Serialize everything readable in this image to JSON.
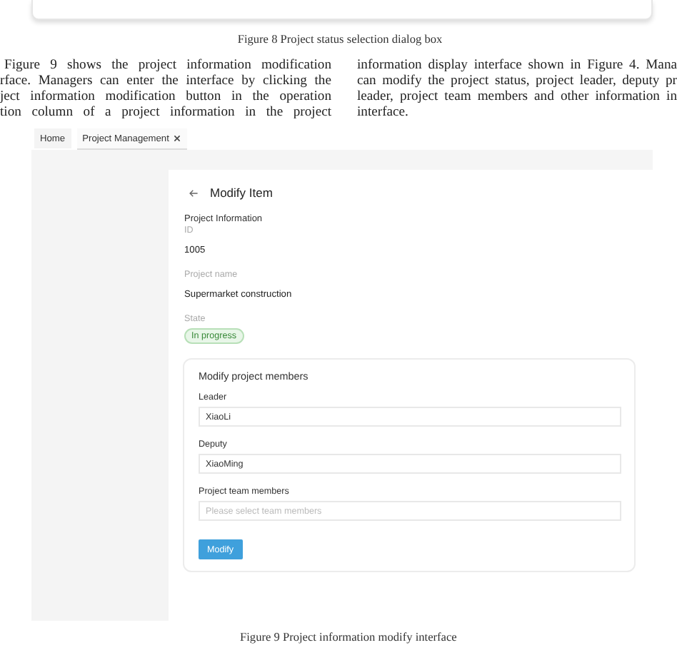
{
  "previous_figure": {
    "caption": "Figure 8 Project status selection dialog box"
  },
  "body_text": {
    "columns": [
      [
        "Figure 9 shows the project information modification",
        "rface. Managers can enter the interface by clicking the",
        "ject information modification button in the operation",
        "tion column of a project information in the project"
      ],
      [
        "information display interface shown in Figure 4. Mana",
        "can modify the project status, project leader, deputy pr",
        "leader, project team members and other information in",
        "interface."
      ]
    ]
  },
  "figure": {
    "tabs": [
      {
        "label": "Home",
        "closable": false,
        "selected": false
      },
      {
        "label": "Project Management",
        "closable": true,
        "selected": true
      }
    ],
    "page_title": "Modify Item",
    "info": {
      "heading": "Project Information",
      "fields": [
        {
          "label": "ID",
          "value": "1005"
        },
        {
          "label": "Project name",
          "value": "Supermarket construction"
        }
      ],
      "state": {
        "label": "State",
        "value": "In progress"
      }
    },
    "members": {
      "title": "Modify project members",
      "fields": [
        {
          "label": "Leader",
          "value": "XiaoLi"
        },
        {
          "label": "Deputy",
          "value": "XiaoMing"
        },
        {
          "label": "Project team members",
          "placeholder": "Please select team members"
        }
      ],
      "button": "Modify"
    },
    "caption": "Figure 9 Project information modify interface"
  }
}
